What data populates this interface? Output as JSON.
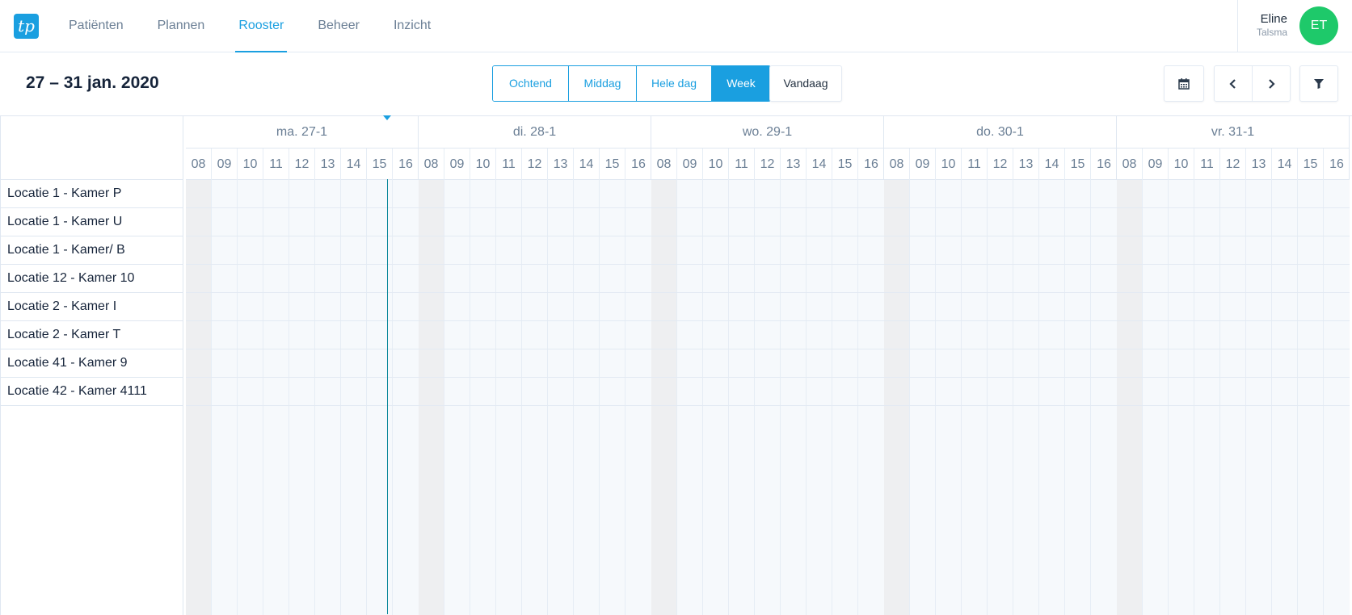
{
  "app": {
    "logo_text": "tp",
    "accent_color": "#1a9fe0"
  },
  "nav": {
    "items": [
      {
        "label": "Patiënten",
        "active": false
      },
      {
        "label": "Plannen",
        "active": false
      },
      {
        "label": "Rooster",
        "active": true
      },
      {
        "label": "Beheer",
        "active": false
      },
      {
        "label": "Inzicht",
        "active": false
      }
    ]
  },
  "user": {
    "first_name": "Eline",
    "last_name": "Talsma",
    "initials": "ET",
    "avatar_color": "#1ec96a"
  },
  "toolbar": {
    "date_range": "27 – 31 jan. 2020",
    "view_options": [
      {
        "label": "Ochtend",
        "active": false
      },
      {
        "label": "Middag",
        "active": false
      },
      {
        "label": "Hele dag",
        "active": false
      },
      {
        "label": "Week",
        "active": true
      }
    ],
    "today_label": "Vandaag",
    "calendar_icon": "calendar-icon",
    "prev_icon": "chevron-left-icon",
    "next_icon": "chevron-right-icon",
    "filter_icon": "filter-icon"
  },
  "schedule": {
    "rooms": [
      "Locatie 1 - Kamer P",
      "Locatie 1 - Kamer U",
      "Locatie 1 - Kamer/ B",
      "Locatie 12 - Kamer 10",
      "Locatie 2 - Kamer I",
      "Locatie 2 - Kamer T",
      "Locatie 41 - Kamer 9",
      "Locatie 42 - Kamer 4111"
    ],
    "days": [
      "ma. 27-1",
      "di. 28-1",
      "wo. 29-1",
      "do. 30-1",
      "vr. 31-1"
    ],
    "hours": [
      "08",
      "09",
      "10",
      "11",
      "12",
      "13",
      "14",
      "15",
      "16"
    ],
    "current_time_day": "ma. 27-1"
  }
}
